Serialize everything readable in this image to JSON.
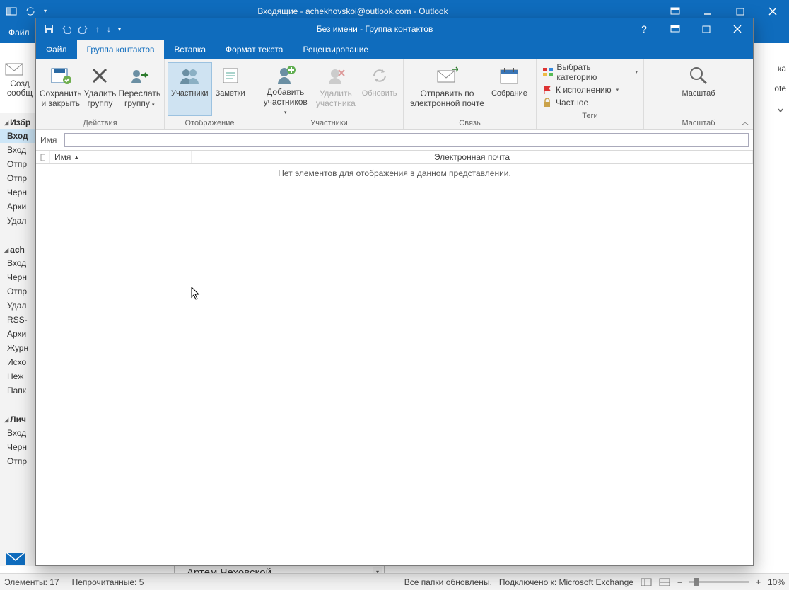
{
  "main_window": {
    "title": "Входящие - achekhovskoi@outlook.com - Outlook",
    "tabs": {
      "file": "Файл"
    },
    "left_panel": {
      "favorites_header": "Избр",
      "items1": [
        "Вход",
        "Вход",
        "Отпр",
        "Отпр",
        "Черн",
        "Архи",
        "Удал"
      ],
      "account_header": "ach",
      "items2": [
        "Вход",
        "Черн",
        "Отпр",
        "Удал",
        "RSS-",
        "Архи",
        "Журн",
        "Исхо",
        "Неж",
        "Папк"
      ],
      "personal_header": "Лич",
      "items3": [
        "Вход",
        "Черн",
        "Отпр"
      ]
    },
    "create_btn": {
      "l1": "Созд",
      "l2": "сообщ"
    },
    "right_frag": {
      "l1": "ка",
      "l2": "ote"
    },
    "person_name": "Артем Чеховской"
  },
  "statusbar": {
    "elements": "Элементы: 17",
    "unread": "Непрочитанные: 5",
    "folders": "Все папки обновлены.",
    "connected": "Подключено к: Microsoft Exchange",
    "zoom": "10%"
  },
  "dialog": {
    "title": "Без имени  -  Группа контактов",
    "tabs": {
      "file": "Файл",
      "group": "Группа контактов",
      "insert": "Вставка",
      "format": "Формат текста",
      "review": "Рецензирование"
    },
    "ribbon": {
      "save_close": {
        "l1": "Сохранить",
        "l2": "и закрыть"
      },
      "delete_group": {
        "l1": "Удалить",
        "l2": "группу"
      },
      "forward_group": {
        "l1": "Переслать",
        "l2": "группу"
      },
      "members_btn": "Участники",
      "notes_btn": "Заметки",
      "add_members": {
        "l1": "Добавить",
        "l2": "участников"
      },
      "remove_member": {
        "l1": "Удалить",
        "l2": "участника"
      },
      "refresh": "Обновить",
      "send_email": {
        "l1": "Отправить по",
        "l2": "электронной почте"
      },
      "meeting": "Собрание",
      "choose_category": "Выбрать категорию",
      "follow_up": "К исполнению",
      "private": "Частное",
      "zoom": "Масштаб",
      "groups": {
        "actions": "Действия",
        "display": "Отображение",
        "members": "Участники",
        "communicate": "Связь",
        "tags": "Теги",
        "zoom": "Масштаб"
      }
    },
    "name_label": "Имя",
    "list": {
      "col_name": "Имя",
      "col_email": "Электронная почта",
      "empty": "Нет элементов для отображения в данном представлении."
    }
  }
}
